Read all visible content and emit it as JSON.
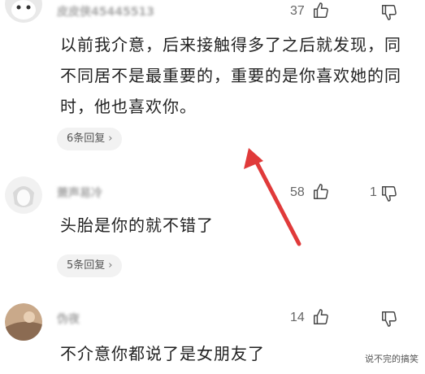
{
  "comments": [
    {
      "username": "皮皮侠45445513",
      "likes": "37",
      "dislikes": "",
      "text": "以前我介意，后来接触得多了之后就发现，同不同居不是最重要的，重要的是你喜欢她的同时，他也喜欢你。",
      "replies_label": "6条回复",
      "replies_chevron": "›"
    },
    {
      "username": "萧声易冷",
      "likes": "58",
      "dislikes": "1",
      "text": "头胎是你的就不错了",
      "replies_label": "5条回复",
      "replies_chevron": "›"
    },
    {
      "username": "伪夜",
      "likes": "14",
      "dislikes": "",
      "text": "不介意你都说了是女朋友了",
      "replies_label": "",
      "replies_chevron": ""
    }
  ],
  "watermark": "说不完的搞笑",
  "colors": {
    "arrow": "#e03a3a",
    "text": "#222222",
    "meta": "#666666",
    "pill_bg": "#f2f2f2"
  },
  "icons": {
    "like": "thumbs-up-icon",
    "dislike": "thumbs-down-icon"
  }
}
